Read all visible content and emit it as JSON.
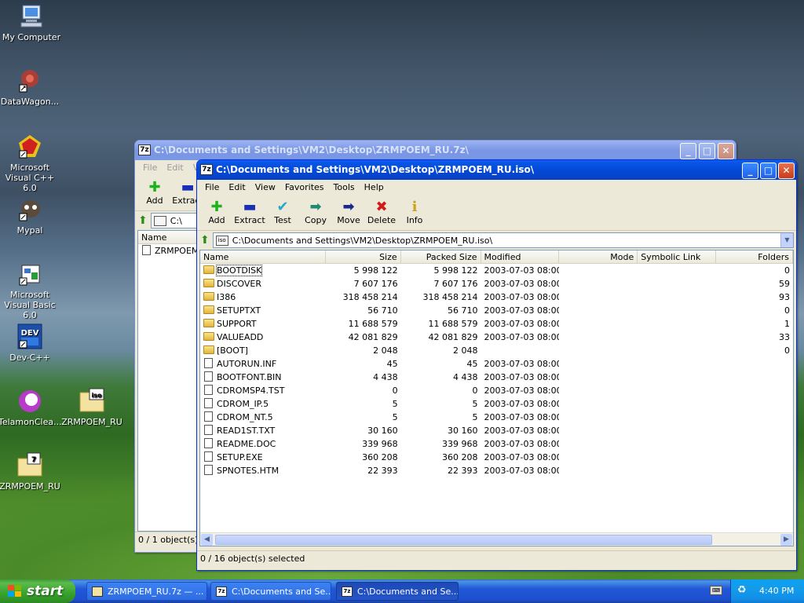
{
  "desktop": {
    "icons": [
      {
        "label": "My Computer",
        "icon": "my-computer-icon"
      },
      {
        "label": "DataWagon...",
        "icon": "datawagon-icon"
      },
      {
        "label": "Microsoft Visual C++ 6.0",
        "icon": "visual-cpp-icon"
      },
      {
        "label": "Mypal",
        "icon": "mypal-icon"
      },
      {
        "label": "Microsoft Visual Basic 6.0",
        "icon": "visual-basic-icon"
      },
      {
        "label": "Dev-C++",
        "icon": "dev-cpp-icon"
      },
      {
        "label": "TelamonClea...",
        "icon": "telamon-icon"
      },
      {
        "label": "ZRMPOEM_RU",
        "icon": "iso-file-icon"
      },
      {
        "label": "ZRMPOEM_RU",
        "icon": "7z-archive-icon"
      }
    ]
  },
  "back_window": {
    "title": "C:\\Documents and Settings\\VM2\\Desktop\\ZRMPOEM_RU.7z\\",
    "menu": [
      "File",
      "Edit",
      "Vie"
    ],
    "toolbar": [
      "Add",
      "Extract"
    ],
    "address": "C:\\",
    "col_name": "Name",
    "item": "ZRMPOEM",
    "status": "0 / 1 object(s) se"
  },
  "front_window": {
    "app_icon_text": "7z",
    "title": "C:\\Documents and Settings\\VM2\\Desktop\\ZRMPOEM_RU.iso\\",
    "menu": [
      "File",
      "Edit",
      "View",
      "Favorites",
      "Tools",
      "Help"
    ],
    "toolbar": [
      {
        "label": "Add",
        "icon": "add-icon",
        "glyph": "✚",
        "color": "#1db31d"
      },
      {
        "label": "Extract",
        "icon": "extract-icon",
        "glyph": "▬",
        "color": "#1a2fb8"
      },
      {
        "label": "Test",
        "icon": "test-icon",
        "glyph": "✔",
        "color": "#27a8c9"
      },
      {
        "label": "Copy",
        "icon": "copy-icon",
        "glyph": "➡",
        "color": "#1e8a74"
      },
      {
        "label": "Move",
        "icon": "move-icon",
        "glyph": "➡",
        "color": "#1a2a8a"
      },
      {
        "label": "Delete",
        "icon": "delete-icon",
        "glyph": "✖",
        "color": "#d11a1a"
      },
      {
        "label": "Info",
        "icon": "info-icon",
        "glyph": "i",
        "color": "#c9a41a"
      }
    ],
    "address": "C:\\Documents and Settings\\VM2\\Desktop\\ZRMPOEM_RU.iso\\",
    "columns": {
      "name": "Name",
      "size": "Size",
      "packed": "Packed Size",
      "modified": "Modified",
      "mode": "Mode",
      "symlink": "Symbolic Link",
      "folders": "Folders"
    },
    "rows": [
      {
        "name": "BOOTDISK",
        "type": "folder",
        "size": "5 998 122",
        "packed": "5 998 122",
        "modified": "2003-07-03 08:00",
        "folders": "0"
      },
      {
        "name": "DISCOVER",
        "type": "folder",
        "size": "7 607 176",
        "packed": "7 607 176",
        "modified": "2003-07-03 08:00",
        "folders": "59"
      },
      {
        "name": "I386",
        "type": "folder",
        "size": "318 458 214",
        "packed": "318 458 214",
        "modified": "2003-07-03 08:00",
        "folders": "93"
      },
      {
        "name": "SETUPTXT",
        "type": "folder",
        "size": "56 710",
        "packed": "56 710",
        "modified": "2003-07-03 08:00",
        "folders": "0"
      },
      {
        "name": "SUPPORT",
        "type": "folder",
        "size": "11 688 579",
        "packed": "11 688 579",
        "modified": "2003-07-03 08:00",
        "folders": "1"
      },
      {
        "name": "VALUEADD",
        "type": "folder",
        "size": "42 081 829",
        "packed": "42 081 829",
        "modified": "2003-07-03 08:00",
        "folders": "33"
      },
      {
        "name": "[BOOT]",
        "type": "folder",
        "size": "2 048",
        "packed": "2 048",
        "modified": "",
        "folders": "0"
      },
      {
        "name": "AUTORUN.INF",
        "type": "file",
        "size": "45",
        "packed": "45",
        "modified": "2003-07-03 08:00",
        "folders": ""
      },
      {
        "name": "BOOTFONT.BIN",
        "type": "file",
        "size": "4 438",
        "packed": "4 438",
        "modified": "2003-07-03 08:00",
        "folders": ""
      },
      {
        "name": "CDROMSP4.TST",
        "type": "file",
        "size": "0",
        "packed": "0",
        "modified": "2003-07-03 08:00",
        "folders": ""
      },
      {
        "name": "CDROM_IP.5",
        "type": "file",
        "size": "5",
        "packed": "5",
        "modified": "2003-07-03 08:00",
        "folders": ""
      },
      {
        "name": "CDROM_NT.5",
        "type": "file",
        "size": "5",
        "packed": "5",
        "modified": "2003-07-03 08:00",
        "folders": ""
      },
      {
        "name": "READ1ST.TXT",
        "type": "file",
        "size": "30 160",
        "packed": "30 160",
        "modified": "2003-07-03 08:00",
        "folders": ""
      },
      {
        "name": "README.DOC",
        "type": "file",
        "size": "339 968",
        "packed": "339 968",
        "modified": "2003-07-03 08:00",
        "folders": ""
      },
      {
        "name": "SETUP.EXE",
        "type": "file",
        "size": "360 208",
        "packed": "360 208",
        "modified": "2003-07-03 08:00",
        "folders": ""
      },
      {
        "name": "SPNOTES.HTM",
        "type": "file",
        "size": "22 393",
        "packed": "22 393",
        "modified": "2003-07-03 08:00",
        "folders": ""
      }
    ],
    "status": "0 / 16 object(s) selected"
  },
  "taskbar": {
    "start_label": "start",
    "tasks": [
      {
        "label": "ZRMPOEM_RU.7z — ...",
        "icon": "folder-icon"
      },
      {
        "label": "C:\\Documents and Se...",
        "icon": "7z-app-icon"
      },
      {
        "label": "C:\\Documents and Se...",
        "icon": "7z-app-icon"
      }
    ],
    "clock": "4:40 PM"
  }
}
